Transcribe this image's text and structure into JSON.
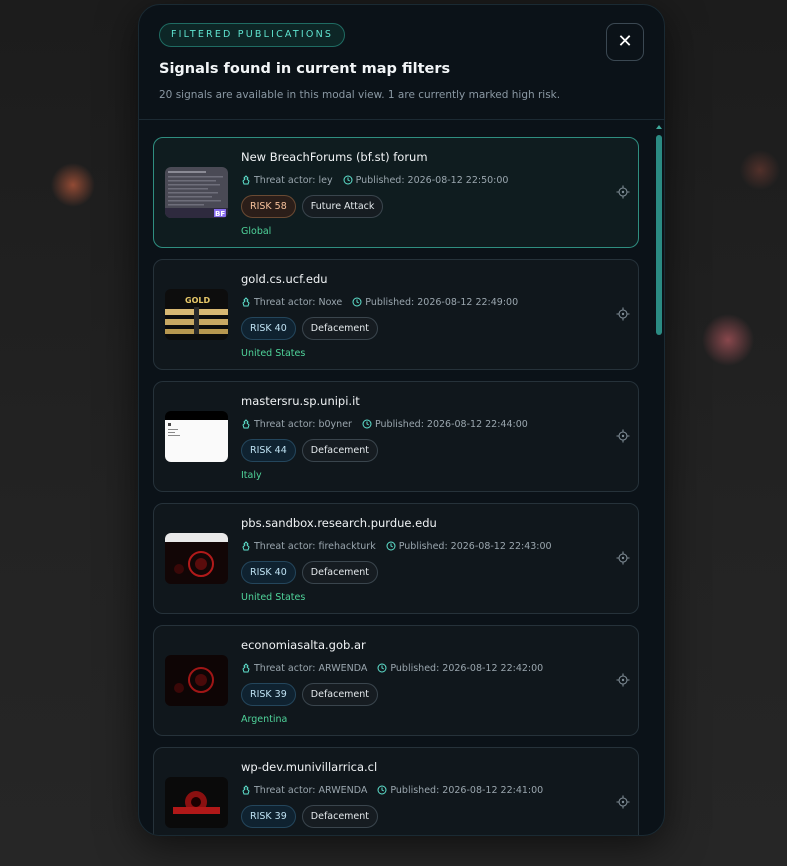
{
  "modal": {
    "badge": "FILTERED PUBLICATIONS",
    "title": "Signals found in current map filters",
    "subtitle": "20 signals are available in this modal view. 1 are currently marked high risk.",
    "close_label": "✕"
  },
  "cards": [
    {
      "title": "New BreachForums (bf.st) forum",
      "actor": "Threat actor: ley",
      "published": "Published: 2026-08-12 22:50:00",
      "risk": "RISK 58",
      "type": "Future Attack",
      "country": "Global"
    },
    {
      "title": "gold.cs.ucf.edu",
      "actor": "Threat actor: Noxe",
      "published": "Published: 2026-08-12 22:49:00",
      "risk": "RISK 40",
      "type": "Defacement",
      "country": "United States"
    },
    {
      "title": "mastersru.sp.unipi.it",
      "actor": "Threat actor: b0yner",
      "published": "Published: 2026-08-12 22:44:00",
      "risk": "RISK 44",
      "type": "Defacement",
      "country": "Italy"
    },
    {
      "title": "pbs.sandbox.research.purdue.edu",
      "actor": "Threat actor: firehackturk",
      "published": "Published: 2026-08-12 22:43:00",
      "risk": "RISK 40",
      "type": "Defacement",
      "country": "United States"
    },
    {
      "title": "economiasalta.gob.ar",
      "actor": "Threat actor: ARWENDA",
      "published": "Published: 2026-08-12 22:42:00",
      "risk": "RISK 39",
      "type": "Defacement",
      "country": "Argentina"
    },
    {
      "title": "wp-dev.munivillarrica.cl",
      "actor": "Threat actor: ARWENDA",
      "published": "Published: 2026-08-12 22:41:00",
      "risk": "RISK 39",
      "type": "Defacement",
      "country": ""
    }
  ],
  "thumbnail_texts": {
    "gold_banner": "GOLD",
    "forum_badge": "BF"
  },
  "colors": {
    "accent": "#5fe3cf",
    "country": "#4fd39a",
    "high_risk": "#f6c19b",
    "risk": "#bfe2f3"
  },
  "icons": {
    "actor": "threat-actor-icon",
    "published": "clock-icon",
    "locate": "crosshair-icon",
    "close": "close-icon"
  }
}
